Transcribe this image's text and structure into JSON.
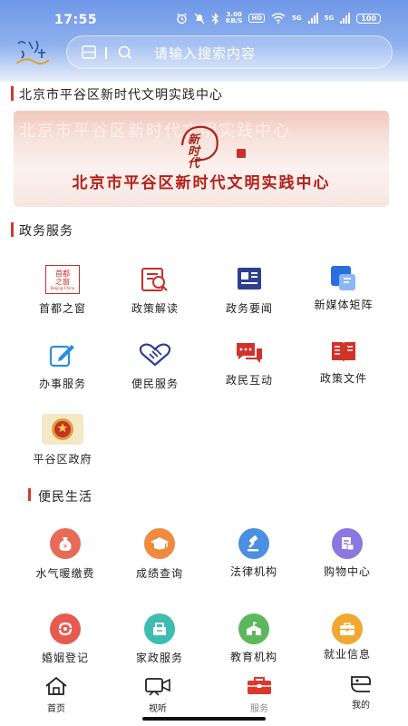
{
  "status_bar": {
    "time": "17:55",
    "net_speed_value": "3.00",
    "net_speed_unit": "KB/S",
    "hd": "HD",
    "signal_5g_1": "5G",
    "signal_5g_2": "5G",
    "battery": "100"
  },
  "header": {
    "logo_text": "北京平谷",
    "search_placeholder": "请输入搜索内容"
  },
  "banner_section": {
    "title": "北京市平谷区新时代文明实践中心",
    "banner_ghost_text": "北京市平谷区新时代文明实践中心",
    "banner_mark_text": "新时代",
    "banner_text": "北京市平谷区新时代文明实践中心"
  },
  "gov_services": {
    "title": "政务服务",
    "items": [
      {
        "label": "首都之窗",
        "icon": "capital-window-icon",
        "color": "#c8302a",
        "icon_text_1": "首都",
        "icon_text_2": "之窗",
        "icon_sub": "Beijing·China"
      },
      {
        "label": "政策解读",
        "icon": "policy-reading-icon",
        "color": "#c8302a"
      },
      {
        "label": "政务要闻",
        "icon": "news-icon",
        "color": "#2d3f8f"
      },
      {
        "label": "新媒体矩阵",
        "icon": "media-matrix-icon",
        "color": "#3d7ee8"
      },
      {
        "label": "办事服务",
        "icon": "edit-icon",
        "color": "#2a8fe0"
      },
      {
        "label": "便民服务",
        "icon": "handshake-icon",
        "color": "#2d3f8f"
      },
      {
        "label": "政民互动",
        "icon": "chat-icon",
        "color": "#d0332a"
      },
      {
        "label": "政策文件",
        "icon": "book-icon",
        "color": "#d0332a"
      },
      {
        "label": "平谷区政府",
        "icon": "emblem-icon",
        "color": "#c8302a"
      }
    ]
  },
  "life_services": {
    "title": "便民生活",
    "items": [
      {
        "label": "水气暖缴费",
        "icon": "money-bag-icon",
        "color": "#e86b57"
      },
      {
        "label": "成绩查询",
        "icon": "graduation-cap-icon",
        "color": "#f08a3c"
      },
      {
        "label": "法律机构",
        "icon": "gavel-icon",
        "color": "#4a8fe0"
      },
      {
        "label": "购物中心",
        "icon": "shopping-icon",
        "color": "#8a78e0"
      },
      {
        "label": "婚姻登记",
        "icon": "marriage-icon",
        "color": "#e85a4f"
      },
      {
        "label": "家政服务",
        "icon": "housekeeping-icon",
        "color": "#3cbdb0"
      },
      {
        "label": "教育机构",
        "icon": "school-icon",
        "color": "#5cb85c"
      },
      {
        "label": "就业信息",
        "icon": "briefcase-icon",
        "color": "#f0a830"
      }
    ]
  },
  "bottom_nav": [
    {
      "label": "首页",
      "icon": "home-icon",
      "active": false
    },
    {
      "label": "视听",
      "icon": "video-icon",
      "active": false
    },
    {
      "label": "服务",
      "icon": "toolbox-icon",
      "active": true
    },
    {
      "label": "我的",
      "icon": "profile-icon",
      "active": false
    }
  ],
  "colors": {
    "accent_red": "#d03a2e",
    "header_blue": "#6f97e8",
    "nav_active": "#e0352b"
  }
}
